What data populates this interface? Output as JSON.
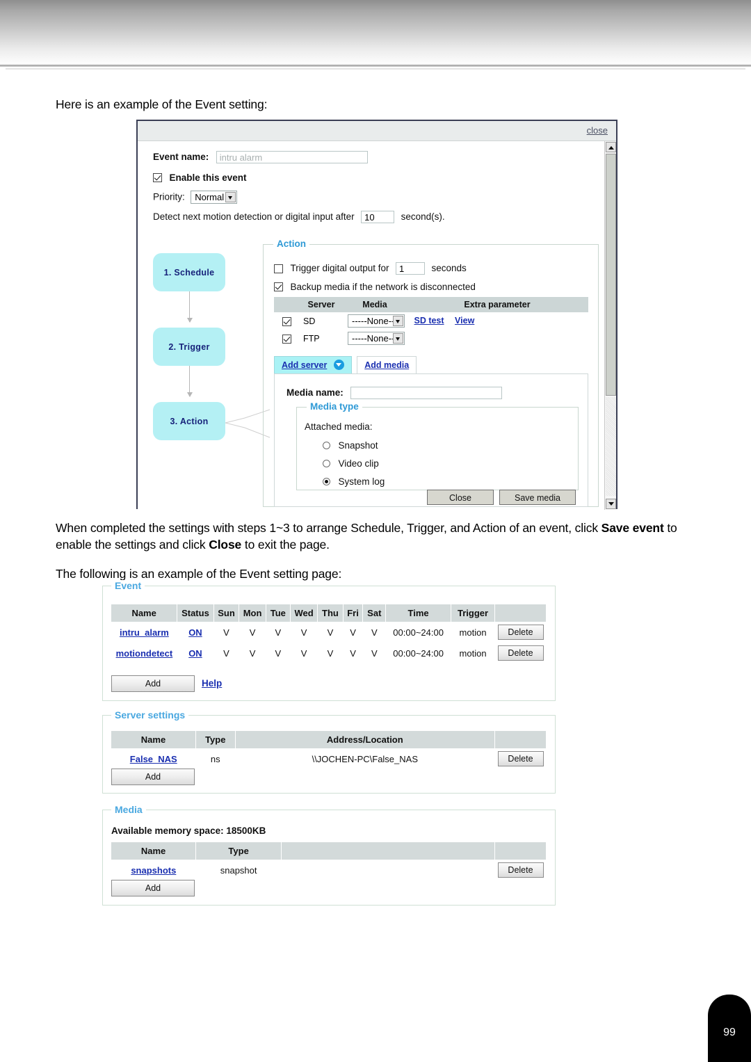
{
  "document": {
    "intro_paragraph": "Here is an example of the Event setting:",
    "middle_paragraph_part1": "When completed the settings with steps 1~3 to arrange Schedule, Trigger, and Action of an event, click ",
    "middle_paragraph_bold1": "Save event",
    "middle_paragraph_part2": " to enable the settings and click ",
    "middle_paragraph_bold2": "Close",
    "middle_paragraph_part3": " to exit the page.",
    "following_paragraph": "The following is an example of the Event setting page:",
    "page_number": "99"
  },
  "dialog": {
    "close_label": "close",
    "event_name_label": "Event name:",
    "event_name_value": "intru alarm",
    "enable_event_label": "Enable this event",
    "enable_event_checked": true,
    "priority_label": "Priority:",
    "priority_value": "Normal",
    "detect_text_before": "Detect next motion detection or digital input after",
    "detect_value": "10",
    "detect_text_after": "second(s).",
    "steps": [
      {
        "label": "1.  Schedule"
      },
      {
        "label": "2.  Trigger"
      },
      {
        "label": "3.  Action"
      }
    ],
    "action": {
      "legend": "Action",
      "trigger_digital_label": "Trigger digital output for",
      "trigger_digital_value": "1",
      "trigger_digital_suffix": "seconds",
      "trigger_digital_checked": false,
      "backup_media_label": "Backup media if the network is disconnected",
      "backup_media_checked": true,
      "table_headers": [
        "",
        "Server",
        "Media",
        "Extra parameter"
      ],
      "rows": [
        {
          "checked": true,
          "server": "SD",
          "media": "-----None-----",
          "extra_links": [
            "SD test",
            "View"
          ]
        },
        {
          "checked": true,
          "server": "FTP",
          "media": "-----None-----",
          "extra_links": []
        }
      ],
      "tabs": [
        {
          "label": "Add server",
          "selected": true,
          "has_dropdown": true
        },
        {
          "label": "Add media",
          "selected": false,
          "has_dropdown": false
        }
      ],
      "media_name_label": "Media name:",
      "media_name_value": "",
      "media_type_legend": "Media type",
      "attached_media_label": "Attached media:",
      "media_options": [
        {
          "label": "Snapshot",
          "selected": false
        },
        {
          "label": "Video clip",
          "selected": false
        },
        {
          "label": "System log",
          "selected": true
        }
      ],
      "close_button": "Close",
      "save_media_button": "Save media"
    }
  },
  "settings_page": {
    "event_panel": {
      "legend": "Event",
      "headers": [
        "Name",
        "Status",
        "Sun",
        "Mon",
        "Tue",
        "Wed",
        "Thu",
        "Fri",
        "Sat",
        "Time",
        "Trigger",
        ""
      ],
      "rows": [
        {
          "name": "intru_alarm",
          "status": "ON",
          "days": [
            "V",
            "V",
            "V",
            "V",
            "V",
            "V",
            "V"
          ],
          "time": "00:00~24:00",
          "trigger": "motion",
          "delete": "Delete"
        },
        {
          "name": "motiondetect",
          "status": "ON",
          "days": [
            "V",
            "V",
            "V",
            "V",
            "V",
            "V",
            "V"
          ],
          "time": "00:00~24:00",
          "trigger": "motion",
          "delete": "Delete"
        }
      ],
      "add_button": "Add",
      "help_link": "Help"
    },
    "server_panel": {
      "legend": "Server settings",
      "headers": [
        "Name",
        "Type",
        "Address/Location",
        ""
      ],
      "rows": [
        {
          "name": "False_NAS",
          "type": "ns",
          "address": "\\\\JOCHEN-PC\\False_NAS",
          "delete": "Delete"
        }
      ],
      "add_button": "Add"
    },
    "media_panel": {
      "legend": "Media",
      "memory_line": "Available memory space: 18500KB",
      "headers": [
        "Name",
        "Type",
        "",
        ""
      ],
      "rows": [
        {
          "name": "snapshots",
          "type": "snapshot",
          "delete": "Delete"
        }
      ],
      "add_button": "Add"
    }
  }
}
